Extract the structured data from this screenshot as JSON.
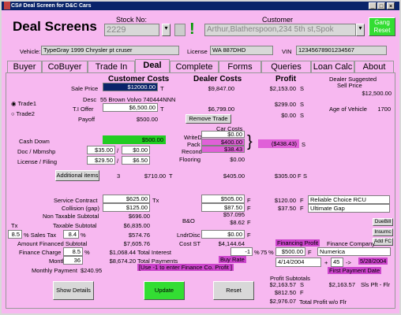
{
  "window": {
    "title": "CS# Deal Screen for D&C Cars"
  },
  "header": {
    "app_title": "Deal Screens",
    "stock_label": "Stock No:",
    "stock_value": "2229",
    "customer_label": "Customer",
    "customer_value": "Arthur,Blatherspoon,234 5th st,Spok",
    "gang_reset": "Gang Reset",
    "vehicle_label": "Vehicle:",
    "vehicle_value": "TypeGray 1999 Chrysler pt cruser",
    "license_label": "License",
    "license_value": "WA 887DHD",
    "vin_label": "VIN",
    "vin_value": "12345678901234567"
  },
  "tabs": [
    "Buyer",
    "CoBuyer",
    "Trade In",
    "Deal",
    "Complete",
    "Forms",
    "Queries",
    "Loan Calc",
    "About"
  ],
  "sections": {
    "customer_costs": "Customer Costs",
    "dealer_costs": "Dealer Costs",
    "profit": "Profit",
    "dealer_suggested": "Dealer Suggested",
    "sell_price": "Sell Price"
  },
  "deal": {
    "sale_price_label": "Sale Price",
    "sale_price": "$12000.00",
    "sale_t": "T",
    "dealer_cost": "$9,847.00",
    "profit_main": "$2,153.00",
    "profit_s": "S",
    "suggested_price": "$12,500.00",
    "desc_label": "Desc",
    "desc_value": "55 Brown Volvo 740444NNN",
    "trade1": "Trade1",
    "trade2": "Trade2",
    "tioffer_label": "T.I Offer",
    "tioffer": "$6,500.00",
    "tioffer_t": "T",
    "dealer_trade": "$6,799.00",
    "profit_trade": "$299.00",
    "profit_trade_s": "S",
    "age_label": "Age of Vehicle",
    "age_value": "1700",
    "payoff_label": "Payoff",
    "payoff": "$500.00",
    "remove_trade": "Remove Trade",
    "profit_payoff": "$0.00",
    "profit_payoff_s": "S",
    "car_costs": "Car Costs",
    "cash_down_label": "Cash Down",
    "cash_down": "$500.00",
    "writed_label": "WriteD",
    "writed": "$0.00",
    "pack_label": "Pack",
    "pack": "$400.00",
    "recond_label": "Recond",
    "recond": "$38.43",
    "flooring_label": "Flooring",
    "flooring": "$0.00",
    "profit_cash": "($438.43)",
    "profit_cash_s": "S",
    "doc_label": "Doc / Mbmshp",
    "doc1": "$35.00",
    "doc2": "$0.00",
    "license_fee_label": "License / Filing",
    "lic1": "$29.50",
    "lic2": "$6.50",
    "additional_label": "Additional items",
    "additional_count": "3",
    "additional_cost": "$710.00",
    "additional_t": "T",
    "additional_dealer": "$405.00",
    "additional_profit": "$305.00",
    "additional_f": "F",
    "additional_s": "S"
  },
  "finance": {
    "service_label": "Service Contract",
    "service": "$625.00",
    "service_tx": "Tx",
    "service_dealer": "$505.00",
    "service_f": "F",
    "service_profit": "$120.00",
    "service_pf": "F",
    "service_vendor": "Reliable Choice RCU",
    "collision_label": "Collision (gap)",
    "collision": "$125.00",
    "collision_dealer": "$87.50",
    "collision_f": "F",
    "collision_profit": "$37.50",
    "collision_pf": "F",
    "collision_vendor": "Ultimate Gap",
    "nontax_label": "Non Taxable Subtotal",
    "nontax": "$696.00",
    "bo_label": "B&O",
    "bo1": "$57.095",
    "bo2": "$8.62",
    "bo_f": "F",
    "tx_label": "Tx",
    "taxable_label": "Taxable Subtotal",
    "taxable": "$6,835.00",
    "rate_value": "8.5",
    "sales_tax_label": "% Sales Tax",
    "sales_tax_pct": "8.4",
    "sales_tax": "$574.76",
    "lndrdisc_label": "LndrDisc",
    "lndrdisc": "$0.00",
    "lndrdisc_f": "F",
    "dueBill": "DueBill",
    "insurnc": "Insurnc",
    "addfc": "Add FC",
    "amt_fin_label": "Amount Financed Subtotal",
    "amt_fin": "$7,605.76",
    "costst_label": "Cost ST",
    "costst": "$4,144.64",
    "fin_profit_label": "Financing Profit",
    "fin_company_label": "Finance Company",
    "fin_charge_label": "Finance Charge",
    "fin_charge_pct": "8.5",
    "fin_charge": "$1,068.44",
    "total_interest_label": "Total Interest",
    "total_interest": "-1",
    "pct75": "75",
    "fin_profit": "$500.00",
    "fin_profit_f": "F",
    "fin_company": "Numerica",
    "months_label": "Months",
    "months": "36",
    "total_payments": "$8,674.20",
    "total_payments_label": "Total Payments",
    "buy_rate": "Buy Rate",
    "date1": "4/14/2004",
    "plus": "+",
    "days": "45",
    "arrow": "->",
    "date2": "5/28/2004",
    "first_payment": "First Payment Date",
    "use_neg": "[Use -1 to enter Finance Co. Profit ]",
    "monthly_label": "Monthly Payment",
    "monthly": "$240.95",
    "profit_subtotals_label": "Profit Subtotals",
    "ps1": "$2,163.57",
    "ps1_s": "S",
    "ps1b": "$2,163.57",
    "ps1_lbl": "Sls Pft - Flr",
    "ps2": "$812.50",
    "ps2_f": "F",
    "ps3": "$2,976.07",
    "total_profit_label": "Total Profit w/o Flr"
  },
  "buttons": {
    "show_details": "Show Details",
    "update": "Update",
    "reset": "Reset"
  }
}
